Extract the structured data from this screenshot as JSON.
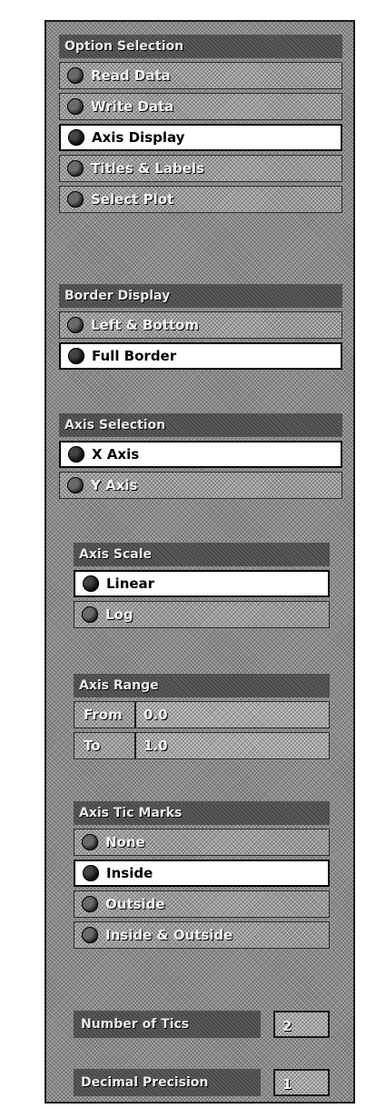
{
  "option_selection": {
    "title": "Option Selection",
    "items": [
      {
        "label": "Read Data",
        "selected": false
      },
      {
        "label": "Write Data",
        "selected": false
      },
      {
        "label": "Axis Display",
        "selected": true
      },
      {
        "label": "Titles & Labels",
        "selected": false
      },
      {
        "label": "Select Plot",
        "selected": false
      }
    ]
  },
  "border_display": {
    "title": "Border Display",
    "items": [
      {
        "label": "Left & Bottom",
        "selected": false
      },
      {
        "label": "Full Border",
        "selected": true
      }
    ]
  },
  "axis_selection": {
    "title": "Axis Selection",
    "items": [
      {
        "label": "X Axis",
        "selected": true
      },
      {
        "label": "Y Axis",
        "selected": false
      }
    ]
  },
  "axis_scale": {
    "title": "Axis Scale",
    "items": [
      {
        "label": "Linear",
        "selected": true
      },
      {
        "label": "Log",
        "selected": false
      }
    ]
  },
  "axis_range": {
    "title": "Axis Range",
    "from_label": "From",
    "from_value": "0.0",
    "to_label": "To",
    "to_value": "1.0"
  },
  "axis_tic_marks": {
    "title": "Axis Tic Marks",
    "items": [
      {
        "label": "None",
        "selected": false
      },
      {
        "label": "Inside",
        "selected": true
      },
      {
        "label": "Outside",
        "selected": false
      },
      {
        "label": "Inside & Outside",
        "selected": false
      }
    ]
  },
  "number_of_tics": {
    "label": "Number of Tics",
    "value": "2"
  },
  "decimal_precision": {
    "label": "Decimal Precision",
    "value": "1"
  }
}
